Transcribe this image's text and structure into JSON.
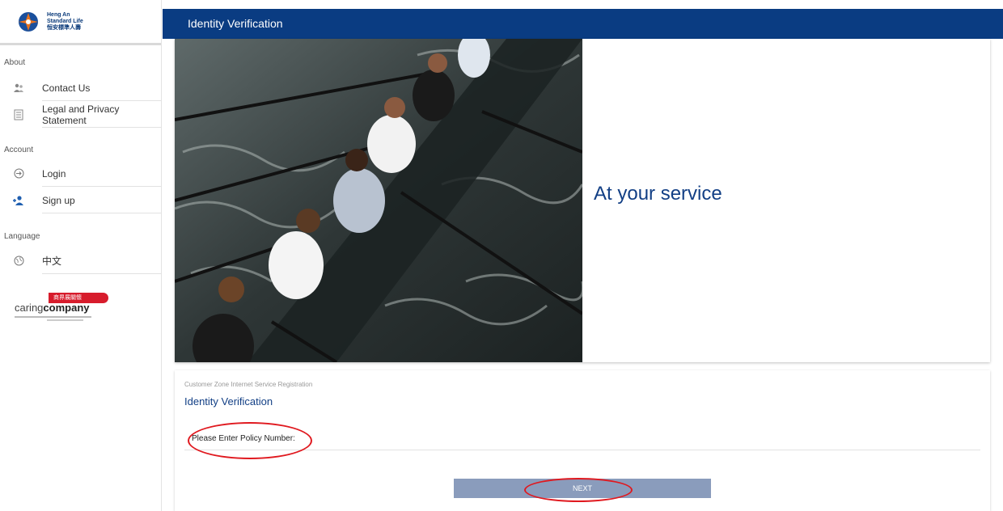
{
  "brand": {
    "name_line1": "Heng An",
    "name_line2": "Standard Life",
    "name_zh": "恒安標準人壽"
  },
  "header": {
    "title": "Identity Verification"
  },
  "sidebar": {
    "sections": [
      {
        "title": "About"
      },
      {
        "title": "Account"
      },
      {
        "title": "Language"
      }
    ],
    "items": [
      {
        "label": "Contact Us",
        "icon": "people-icon"
      },
      {
        "label": "Legal and Privacy Statement",
        "icon": "document-icon"
      },
      {
        "label": "Login",
        "icon": "login-icon"
      },
      {
        "label": "Sign up",
        "icon": "add-user-icon"
      },
      {
        "label": "中文",
        "icon": "globe-icon"
      }
    ],
    "caring_logo": {
      "badge_zh": "商界展關懷",
      "word1": "caring",
      "word2": "company"
    }
  },
  "hero": {
    "caption": "At your service"
  },
  "form": {
    "subtitle": "Customer Zone Internet Service Registration",
    "title": "Identity Verification",
    "field_label": "Please Enter Policy Number:",
    "next_label": "NEXT"
  },
  "colors": {
    "header_bg": "#0a3c82",
    "accent_text": "#123f85",
    "button_bg": "#8a9cbc",
    "annotation": "#e0191f"
  }
}
